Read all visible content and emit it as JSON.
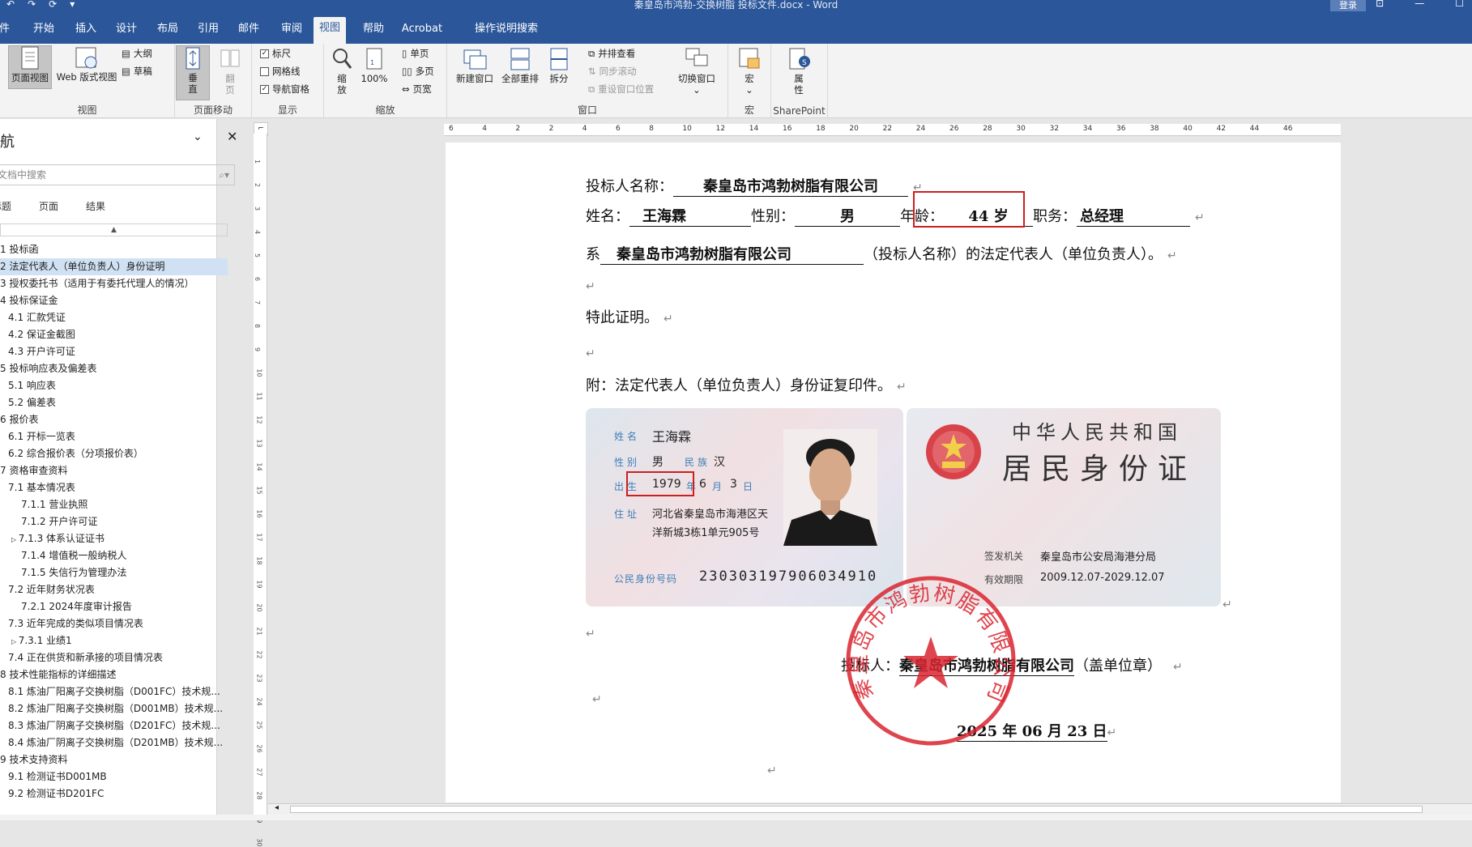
{
  "window": {
    "title": "秦皇岛市鸿勃-交换树脂 投标文件.docx - Word",
    "login_label": "登录",
    "quick_access": [
      "↶",
      "↷",
      "⟳",
      "▾"
    ]
  },
  "tabs": [
    "文件",
    "开始",
    "插入",
    "设计",
    "布局",
    "引用",
    "邮件",
    "审阅",
    "视图",
    "帮助",
    "Acrobat",
    "操作说明搜索"
  ],
  "active_tab": "视图",
  "ribbon": {
    "views": {
      "label": "视图",
      "page_view": "页面视图",
      "web_view": "Web 版式视图",
      "outline": "大纲",
      "draft": "草稿"
    },
    "page_move": {
      "label": "页面移动",
      "vertical": "垂直",
      "flip": "翻页"
    },
    "show": {
      "label": "显示",
      "ruler": "标尺",
      "gridlines": "网格线",
      "nav_pane": "导航窗格",
      "ruler_checked": true,
      "gridlines_checked": false,
      "nav_checked": true
    },
    "zoom": {
      "label": "缩放",
      "zoom": "缩放",
      "hundred": "100%",
      "one_page": "单页",
      "multi_page": "多页",
      "page_width": "页宽"
    },
    "window": {
      "label": "窗口",
      "new_window": "新建窗口",
      "arrange_all": "全部重排",
      "split": "拆分",
      "side_by_side": "并排查看",
      "sync_scroll": "同步滚动",
      "reset_pos": "重设窗口位置",
      "switch_window": "切换窗口"
    },
    "macro": {
      "label": "宏",
      "macro": "宏"
    },
    "sharepoint": {
      "label": "SharePoint",
      "properties": "属性"
    }
  },
  "nav": {
    "title": "导航",
    "search_placeholder": "在文档中搜索",
    "tabs": [
      "标题",
      "页面",
      "结果"
    ],
    "items": [
      {
        "text": "1 投标函",
        "indent": 0
      },
      {
        "text": "2 法定代表人（单位负责人）身份证明",
        "indent": 0,
        "selected": true
      },
      {
        "text": "3 授权委托书（适用于有委托代理人的情况）",
        "indent": 0
      },
      {
        "text": "4 投标保证金",
        "indent": 0
      },
      {
        "text": "4.1 汇款凭证",
        "indent": 1
      },
      {
        "text": "4.2 保证金截图",
        "indent": 1
      },
      {
        "text": "4.3 开户许可证",
        "indent": 1
      },
      {
        "text": "5 投标响应表及偏差表",
        "indent": 0
      },
      {
        "text": "5.1 响应表",
        "indent": 1
      },
      {
        "text": "5.2 偏差表",
        "indent": 1
      },
      {
        "text": "6 报价表",
        "indent": 0
      },
      {
        "text": "6.1 开标一览表",
        "indent": 1
      },
      {
        "text": "6.2 综合报价表（分项报价表）",
        "indent": 1
      },
      {
        "text": "7 资格审查资料",
        "indent": 0
      },
      {
        "text": "7.1 基本情况表",
        "indent": 1
      },
      {
        "text": "7.1.1 营业执照",
        "indent": 2
      },
      {
        "text": "7.1.2 开户许可证",
        "indent": 2
      },
      {
        "text": "7.1.3 体系认证证书",
        "indent": 2,
        "collapsed": true
      },
      {
        "text": "7.1.4 增值税一般纳税人",
        "indent": 2
      },
      {
        "text": "7.1.5 失信行为管理办法",
        "indent": 2
      },
      {
        "text": "7.2 近年财务状况表",
        "indent": 1
      },
      {
        "text": "7.2.1 2024年度审计报告",
        "indent": 2
      },
      {
        "text": "7.3 近年完成的类似项目情况表",
        "indent": 1
      },
      {
        "text": "7.3.1 业绩1",
        "indent": 2,
        "collapsed": true
      },
      {
        "text": "7.4 正在供货和新承接的项目情况表",
        "indent": 1
      },
      {
        "text": "8 技术性能指标的详细描述",
        "indent": 0
      },
      {
        "text": "8.1 炼油厂阳离子交换树脂（D001FC）技术规...",
        "indent": 1
      },
      {
        "text": "8.2 炼油厂阳离子交换树脂（D001MB）技术规...",
        "indent": 1
      },
      {
        "text": "8.3 炼油厂阴离子交换树脂（D201FC）技术规...",
        "indent": 1
      },
      {
        "text": "8.4 炼油厂阴离子交换树脂（D201MB）技术规...",
        "indent": 1
      },
      {
        "text": "9 技术支持资料",
        "indent": 0
      },
      {
        "text": "9.1 检测证书D001MB",
        "indent": 1
      },
      {
        "text": "9.2 检测证书D201FC",
        "indent": 1
      }
    ]
  },
  "ruler": {
    "h_ticks": [
      "6",
      "4",
      "2",
      "2",
      "4",
      "6",
      "8",
      "10",
      "12",
      "14",
      "16",
      "18",
      "20",
      "22",
      "24",
      "26",
      "28",
      "30",
      "32",
      "34",
      "36",
      "38",
      "40",
      "42",
      "44",
      "46"
    ],
    "v_ticks": [
      "1",
      "2",
      "3",
      "4",
      "5",
      "6",
      "7",
      "8",
      "9",
      "10",
      "11",
      "12",
      "13",
      "14",
      "15",
      "16",
      "17",
      "18",
      "19",
      "20",
      "21",
      "22",
      "23",
      "24",
      "25",
      "26",
      "27",
      "28",
      "29",
      "30"
    ]
  },
  "doc": {
    "bidder_label": "投标人名称：",
    "bidder_name": "秦皇岛市鸿勃树脂有限公司",
    "name_label": "姓名：",
    "name_value": "王海霖",
    "gender_label": "性别：",
    "gender_value": "男",
    "age_label": "年龄：",
    "age_value": "44 岁",
    "title_label": "职务：",
    "title_value": "总经理",
    "is_label": "系",
    "is_company": "秦皇岛市鸿勃树脂有限公司",
    "is_tail": "（投标人名称）的法定代表人（单位负责人）。",
    "certify": "特此证明。",
    "attach": "附：法定代表人（单位负责人）身份证复印件。",
    "sign_label": "投标人：",
    "sign_company": "秦皇岛市鸿勃树脂有限公司",
    "sign_tail": "（盖单位章）",
    "date": "2025 年 06 月 23 日",
    "para_mark": "↵"
  },
  "id_front": {
    "name_label": "姓名",
    "name": "王海霖",
    "gender_label": "性别",
    "gender": "男",
    "ethnic_label": "民族",
    "ethnic": "汉",
    "birth_label": "出生",
    "birth_year": "1979",
    "year_unit": "年",
    "birth_month": "6",
    "month_unit": "月",
    "birth_day": "3",
    "day_unit": "日",
    "addr_label": "住址",
    "addr1": "河北省秦皇岛市海港区天",
    "addr2": "洋新城3栋1单元905号",
    "id_label": "公民身份号码",
    "id_number": "230303197906034910"
  },
  "id_back": {
    "country": "中华人民共和国",
    "card_title": "居民身份证",
    "issuer_label": "签发机关",
    "issuer": "秦皇岛市公安局海港分局",
    "valid_label": "有效期限",
    "valid": "2009.12.07-2029.12.07"
  },
  "stamp": {
    "text": "秦皇岛市鸿勃树脂有限公司",
    "color": "#d9242f"
  },
  "colors": {
    "brand": "#2b579a",
    "highlight_box": "#cc1f1f",
    "nav_selected": "#cfe1f3"
  }
}
